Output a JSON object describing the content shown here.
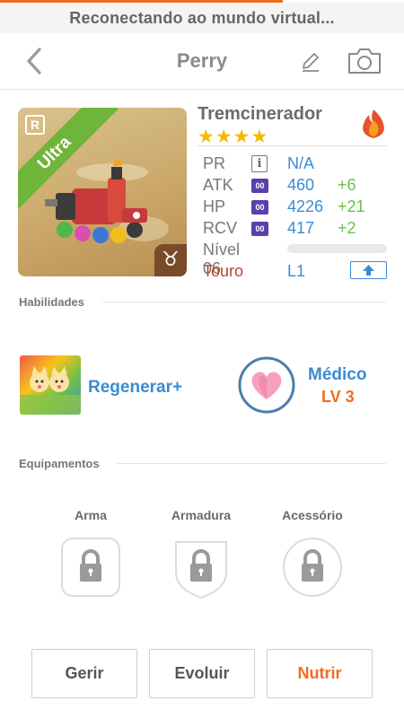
{
  "status": {
    "message": "Reconectando ao mundo virtual..."
  },
  "header": {
    "title": "Perry",
    "back_icon": "chevron-left-icon",
    "edit_icon": "pencil-icon",
    "camera_icon": "camera-icon"
  },
  "monster": {
    "name": "Tremcinerador",
    "rarity_letter": "R",
    "rarity_label": "Ultra",
    "stars": "★★★★",
    "star_count": 4,
    "element": "fire",
    "zodiac_glyph": "♉",
    "stats": [
      {
        "label": "PR",
        "badge": "i",
        "value": "N/A",
        "bonus": ""
      },
      {
        "label": "ATK",
        "badge": "00",
        "value": "460",
        "bonus": "+6"
      },
      {
        "label": "HP",
        "badge": "00",
        "value": "4226",
        "bonus": "+21"
      },
      {
        "label": "RCV",
        "badge": "00",
        "value": "417",
        "bonus": "+2"
      }
    ],
    "level_label": "Nível 06",
    "experience_progress": 0,
    "sign_label": "Touro",
    "sign_level": "L1"
  },
  "sections": {
    "skills_title": "Habilidades",
    "equipment_title": "Equipamentos"
  },
  "skills": {
    "active": {
      "name": "Regenerar+"
    },
    "leader": {
      "name": "Médico",
      "level": "LV 3"
    }
  },
  "equipment": [
    {
      "label": "Arma",
      "shape": "rounded-square",
      "locked": true
    },
    {
      "label": "Armadura",
      "shape": "shield",
      "locked": true
    },
    {
      "label": "Acessório",
      "shape": "circle",
      "locked": true
    }
  ],
  "actions": {
    "manage": "Gerir",
    "evolve": "Evoluir",
    "feed": "Nutrir"
  },
  "colors": {
    "accent": "#f26b22",
    "link_blue": "#3b8bd4",
    "bonus_green": "#6cc04a",
    "star_gold": "#f5b800",
    "badge_purple": "#5a3fa8"
  }
}
